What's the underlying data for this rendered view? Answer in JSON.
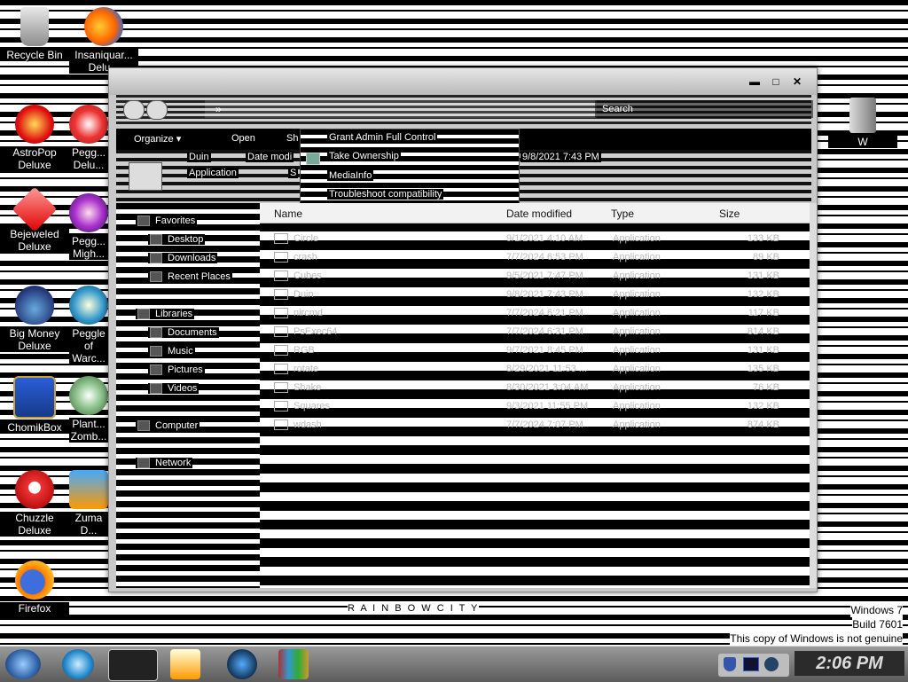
{
  "desktop": {
    "icons": [
      {
        "label": "Recycle Bin",
        "icon": "recycle-bin-icon"
      },
      {
        "label": "Insaniquar... Delu...",
        "icon": "fish-icon"
      },
      {
        "label": "AstroPop Deluxe",
        "icon": "astropop-icon"
      },
      {
        "label": "Pegg... Delu...",
        "icon": "peggle-icon"
      },
      {
        "label": "Bejeweled Deluxe",
        "icon": "gem-icon"
      },
      {
        "label": "Pegg... Migh...",
        "icon": "peggle-nights-icon"
      },
      {
        "label": "Big Money Deluxe",
        "icon": "money-bag-icon"
      },
      {
        "label": "Peggle of Warc...",
        "icon": "peggle-warcraft-icon"
      },
      {
        "label": "ChomikBox",
        "icon": "chomikbox-icon"
      },
      {
        "label": "Plant... Zomb...",
        "icon": "plants-zombies-icon"
      },
      {
        "label": "Chuzzle Deluxe",
        "icon": "chuzzle-icon"
      },
      {
        "label": "Zuma D...",
        "icon": "zuma-icon"
      },
      {
        "label": "Firefox",
        "icon": "firefox-icon"
      },
      {
        "label": "W",
        "icon": "archive-icon"
      }
    ],
    "watermark": {
      "line1": "Windows 7",
      "line2": "Build 7601",
      "line3": "This copy of Windows is not genuine"
    },
    "banner": "R A I N B O W C I T Y"
  },
  "window": {
    "controls": {
      "minimize": "▬",
      "maximize": "□",
      "close": "✕"
    },
    "address": "»",
    "search_placeholder": "Search",
    "toolbar": {
      "organize": "Organize ▾",
      "open": "Open",
      "share": "Sh"
    },
    "context_menu": [
      "Grant Admin Full Control",
      "Take Ownership",
      "MediaInfo",
      "Troubleshoot compatibility"
    ],
    "details": {
      "name": "Duin",
      "type": "Application",
      "date_label": "Date modi",
      "size_prefix": "S",
      "date_value": "9/8/2021 7:43 PM"
    },
    "nav": {
      "favorites": "Favorites",
      "desktop": "Desktop",
      "downloads": "Downloads",
      "recent": "Recent Places",
      "libraries": "Libraries",
      "documents": "Documents",
      "music": "Music",
      "pictures": "Pictures",
      "videos": "Videos",
      "computer": "Computer",
      "network": "Network"
    },
    "columns": {
      "name": "Name",
      "date": "Date modified",
      "type": "Type",
      "size": "Size"
    },
    "files": [
      {
        "name": "Circle",
        "date": "9/1/2021 4:10 AM",
        "type": "Application",
        "size": "133 KB"
      },
      {
        "name": "crash",
        "date": "7/7/2024 6:53 PM",
        "type": "Application",
        "size": "89 KB"
      },
      {
        "name": "Cubes",
        "date": "9/5/2021 7:47 PM",
        "type": "Application",
        "size": "131 KB"
      },
      {
        "name": "Duin",
        "date": "9/8/2021 7:43 PM",
        "type": "Application",
        "size": "132 KB"
      },
      {
        "name": "nircmd",
        "date": "7/7/2024 6:21 PM",
        "type": "Application",
        "size": "117 KB"
      },
      {
        "name": "PsExec64",
        "date": "7/7/2024 6:31 PM",
        "type": "Application",
        "size": "814 KB"
      },
      {
        "name": "RGB",
        "date": "9/7/2021 8:45 PM",
        "type": "Application",
        "size": "131 KB"
      },
      {
        "name": "rotate",
        "date": "8/29/2021 11:53 ...",
        "type": "Application",
        "size": "135 KB"
      },
      {
        "name": "Shake",
        "date": "8/30/2021 3:04 AM",
        "type": "Application",
        "size": "76 KB"
      },
      {
        "name": "Squares",
        "date": "9/3/2021 11:55 PM",
        "type": "Application",
        "size": "132 KB"
      },
      {
        "name": "wdash",
        "date": "7/7/2024 7:07 PM",
        "type": "Application",
        "size": "874 KB"
      }
    ]
  },
  "taskbar": {
    "apps": [
      "start-orb-icon",
      "internet-explorer-icon",
      "explorer-window-icon",
      "media-player-icon",
      "globe-icon",
      "winrar-icon"
    ],
    "tray": [
      "shield-icon",
      "monitor-icon",
      "volume-icon"
    ],
    "clock": "2:06 PM"
  }
}
